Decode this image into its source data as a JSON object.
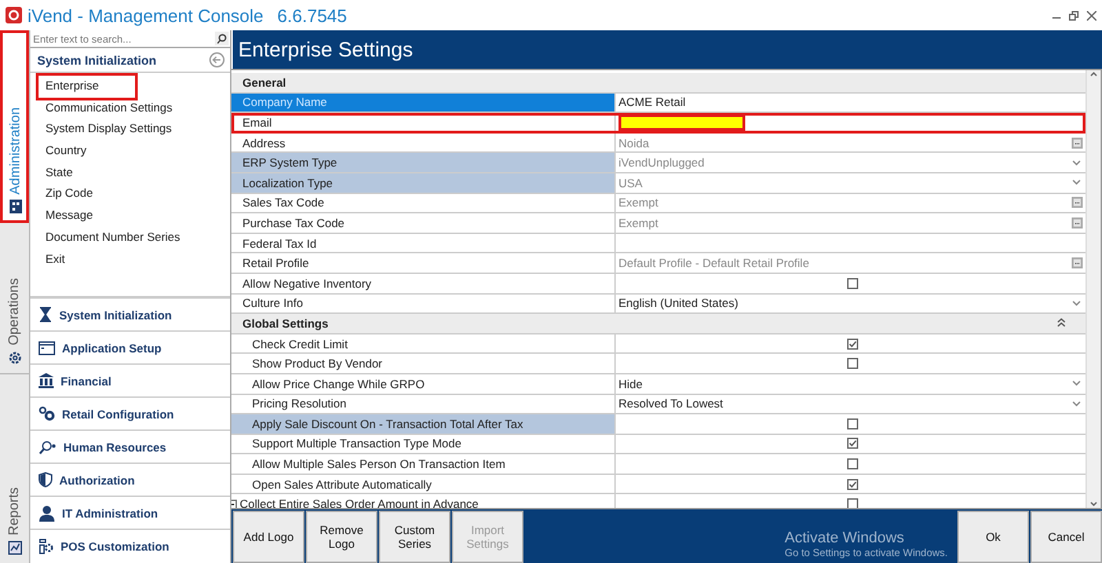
{
  "window": {
    "title": "iVend - Management Console",
    "version": "6.6.7545"
  },
  "vertical_tabs": [
    {
      "label": "Administration",
      "selected": true,
      "highlighted": true
    },
    {
      "label": "Operations",
      "selected": false,
      "highlighted": false
    },
    {
      "label": "Reports",
      "selected": false,
      "highlighted": false
    }
  ],
  "sidebar": {
    "search": {
      "placeholder": "Enter text to search..."
    },
    "heading": "System Initialization",
    "items": [
      {
        "label": "Enterprise",
        "highlighted": true
      },
      {
        "label": "Communication Settings",
        "highlighted": false
      },
      {
        "label": "System Display Settings",
        "highlighted": false
      },
      {
        "label": "Country",
        "highlighted": false
      },
      {
        "label": "State",
        "highlighted": false
      },
      {
        "label": "Zip Code",
        "highlighted": false
      },
      {
        "label": "Message",
        "highlighted": false
      },
      {
        "label": "Document Number Series",
        "highlighted": false
      },
      {
        "label": "Exit",
        "highlighted": false
      }
    ],
    "groups": [
      {
        "label": "System Initialization"
      },
      {
        "label": "Application Setup"
      },
      {
        "label": "Financial"
      },
      {
        "label": "Retail Configuration"
      },
      {
        "label": "Human Resources"
      },
      {
        "label": "Authorization"
      },
      {
        "label": "IT Administration"
      },
      {
        "label": "POS Customization"
      }
    ]
  },
  "page": {
    "title": "Enterprise Settings"
  },
  "sections": [
    {
      "title": "General",
      "collapse_button": false,
      "rows": [
        {
          "label": "Company Name",
          "kind": "text",
          "value": "ACME Retail",
          "readonly": false,
          "selected": true,
          "highlighted": false,
          "marked": false
        },
        {
          "label": "Email",
          "kind": "text",
          "selected": false,
          "highlighted": false,
          "marked": true
        },
        {
          "label": "Address",
          "kind": "lookup",
          "value": "Noida",
          "readonly": true,
          "selected": false,
          "highlighted": false,
          "marked": false
        },
        {
          "label": "ERP System Type",
          "kind": "dropdown",
          "value": "iVendUnplugged",
          "readonly": true,
          "selected": false,
          "highlighted": true,
          "marked": false
        },
        {
          "label": "Localization Type",
          "kind": "dropdown",
          "value": "USA",
          "readonly": true,
          "selected": false,
          "highlighted": true,
          "marked": false
        },
        {
          "label": "Sales Tax Code",
          "kind": "lookup",
          "value": "Exempt",
          "readonly": true,
          "selected": false,
          "highlighted": false,
          "marked": false
        },
        {
          "label": "Purchase Tax Code",
          "kind": "lookup",
          "value": "Exempt",
          "readonly": true,
          "selected": false,
          "highlighted": false,
          "marked": false
        },
        {
          "label": "Federal Tax Id",
          "kind": "text",
          "selected": false,
          "highlighted": false,
          "marked": false
        },
        {
          "label": "Retail Profile",
          "kind": "lookup",
          "value": "Default Profile - Default Retail Profile",
          "readonly": true,
          "selected": false,
          "highlighted": false,
          "marked": false
        },
        {
          "label": "Allow Negative Inventory",
          "kind": "checkbox",
          "checked": false,
          "selected": false,
          "highlighted": false,
          "marked": false
        },
        {
          "label": "Culture Info",
          "kind": "dropdown",
          "value": "English (United States)",
          "readonly": false,
          "selected": false,
          "highlighted": false,
          "marked": false
        }
      ]
    },
    {
      "title": "Global Settings",
      "collapse_button": true,
      "rows": [
        {
          "label": "Check Credit Limit",
          "kind": "checkbox",
          "checked": true,
          "selected": false,
          "highlighted": false,
          "marked": false
        },
        {
          "label": "Show Product By Vendor",
          "kind": "checkbox",
          "checked": false,
          "selected": false,
          "highlighted": false,
          "marked": false
        },
        {
          "label": "Allow Price Change While GRPO",
          "kind": "dropdown",
          "value": "Hide",
          "readonly": false,
          "selected": false,
          "highlighted": false,
          "marked": false
        },
        {
          "label": "Pricing Resolution",
          "kind": "dropdown",
          "value": "Resolved To Lowest",
          "readonly": false,
          "selected": false,
          "highlighted": false,
          "marked": false
        },
        {
          "label": "Apply Sale Discount On - Transaction Total After Tax",
          "kind": "checkbox",
          "checked": false,
          "selected": false,
          "highlighted": true,
          "marked": false
        },
        {
          "label": "Support Multiple Transaction Type Mode",
          "kind": "checkbox",
          "checked": true,
          "selected": false,
          "highlighted": false,
          "marked": false
        },
        {
          "label": "Allow Multiple Sales Person On Transaction Item",
          "kind": "checkbox",
          "checked": false,
          "selected": false,
          "highlighted": false,
          "marked": false
        },
        {
          "label": "Open Sales Attribute Automatically",
          "kind": "checkbox",
          "checked": true,
          "selected": false,
          "highlighted": false,
          "marked": false
        },
        {
          "label": "Collect Entire Sales Order Amount in Advance",
          "kind": "group-checkbox",
          "checked": false,
          "selected": false,
          "highlighted": false,
          "marked": false
        }
      ]
    }
  ],
  "footer": {
    "left_buttons": [
      {
        "label": "Add Logo",
        "disabled": false
      },
      {
        "label": "Remove Logo",
        "disabled": false
      },
      {
        "label": "Custom Series",
        "disabled": false
      },
      {
        "label": "Import Settings",
        "disabled": true
      }
    ],
    "right_buttons": [
      {
        "label": "Ok",
        "disabled": false
      },
      {
        "label": "Cancel",
        "disabled": false
      }
    ]
  },
  "activation_notice": {
    "title": "Activate Windows",
    "subtitle": "Go to Settings to activate Windows."
  }
}
